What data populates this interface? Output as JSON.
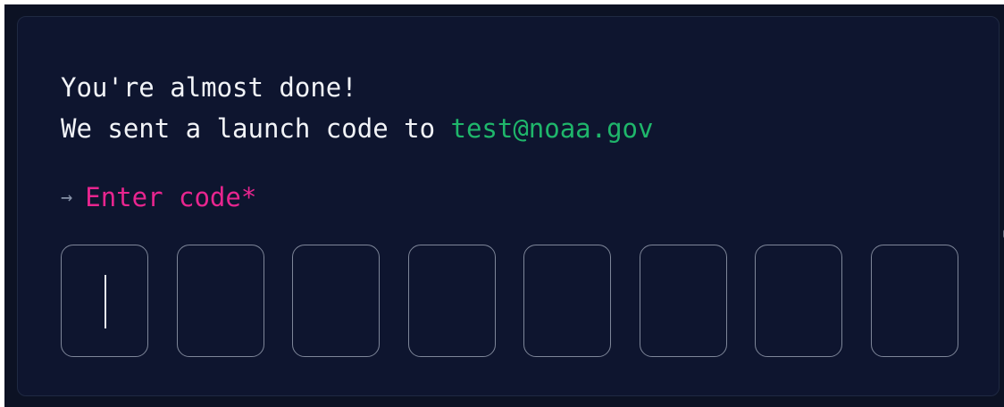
{
  "heading": {
    "line1": "You're almost done!",
    "line2_prefix": "We sent a launch code to ",
    "email": "test@noaa.gov"
  },
  "code_field": {
    "arrow_icon": "→",
    "label": "Enter code*",
    "digit_count": 8,
    "values": [
      "",
      "",
      "",
      "",
      "",
      "",
      "",
      ""
    ]
  },
  "colors": {
    "background": "#0e152f",
    "email": "#1fb66b",
    "label": "#e8258f"
  }
}
